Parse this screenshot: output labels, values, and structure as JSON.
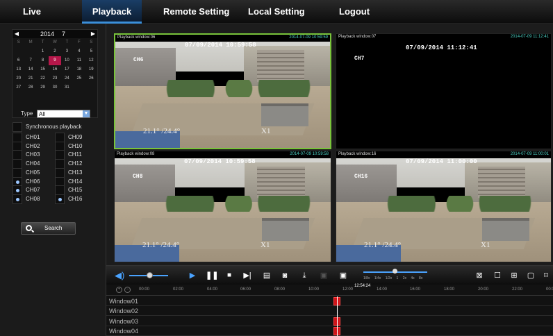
{
  "nav": {
    "tabs": [
      "Live",
      "Playback",
      "Remote Setting",
      "Local Setting",
      "Logout"
    ],
    "active": "Playback",
    "accent": "#3b8fd9"
  },
  "calendar": {
    "year": "2014",
    "month": "7",
    "prev": "◀",
    "next": "▶",
    "weekdays": [
      "S",
      "M",
      "T",
      "W",
      "T",
      "F",
      "S"
    ],
    "weeks": [
      [
        "",
        "",
        "1",
        "2",
        "3",
        "4",
        "5"
      ],
      [
        "6",
        "7",
        "8",
        "9",
        "10",
        "11",
        "12"
      ],
      [
        "13",
        "14",
        "15",
        "16",
        "17",
        "18",
        "19"
      ],
      [
        "20",
        "21",
        "22",
        "23",
        "24",
        "25",
        "26"
      ],
      [
        "27",
        "28",
        "29",
        "30",
        "31",
        "",
        ""
      ]
    ],
    "selected_day": "9",
    "selected_color": "#b5174a"
  },
  "filter": {
    "type_label": "Type",
    "type_value": "All",
    "sync_label": "Synchronous playback"
  },
  "channels": {
    "left": [
      {
        "label": "CH01",
        "checked": false
      },
      {
        "label": "CH02",
        "checked": false
      },
      {
        "label": "CH03",
        "checked": false
      },
      {
        "label": "CH04",
        "checked": false
      },
      {
        "label": "CH05",
        "checked": false
      },
      {
        "label": "CH06",
        "checked": true
      },
      {
        "label": "CH07",
        "checked": true
      },
      {
        "label": "CH08",
        "checked": true
      }
    ],
    "right": [
      {
        "label": "CH09",
        "checked": false
      },
      {
        "label": "CH10",
        "checked": false
      },
      {
        "label": "CH11",
        "checked": false
      },
      {
        "label": "CH12",
        "checked": false
      },
      {
        "label": "CH13",
        "checked": false
      },
      {
        "label": "CH14",
        "checked": false
      },
      {
        "label": "CH15",
        "checked": false
      },
      {
        "label": "CH16",
        "checked": true
      }
    ]
  },
  "search_label": "Search",
  "windows": [
    {
      "title": "Playback window:06",
      "timestamp": "2014-07-09 10:59:59",
      "osd_time": "07/09/2014 10:59:58",
      "channel": "CH6",
      "bottom_left": "21.1° /24.4°",
      "bottom_right": "X1",
      "active": true,
      "has_video": true
    },
    {
      "title": "Playback window:07",
      "timestamp": "2014-07-09 11:12:41",
      "osd_time": "07/09/2014 11:12:41",
      "channel": "CH7",
      "bottom_left": "",
      "bottom_right": "",
      "active": false,
      "has_video": false
    },
    {
      "title": "Playback window:08",
      "timestamp": "2014-07-09 10:59:58",
      "osd_time": "07/09/2014 10:59:58",
      "channel": "CH8",
      "bottom_left": "21.1° /24.4°",
      "bottom_right": "X1",
      "active": false,
      "has_video": true
    },
    {
      "title": "Playback window:16",
      "timestamp": "2014-07-09 11:00:01",
      "osd_time": "07/09/2014 11:00:00",
      "channel": "CH16",
      "bottom_left": "21.1° /24.4°",
      "bottom_right": "X1",
      "active": false,
      "has_video": true
    }
  ],
  "controls": {
    "volume_level": 0.45,
    "speed_labels": [
      "1/8x",
      "1/4x",
      "1/2x",
      "1",
      "2x",
      "4x",
      "8x"
    ],
    "speed_value": "1"
  },
  "timeline": {
    "ticks": [
      "00:00",
      "02:00",
      "04:00",
      "06:00",
      "08:00",
      "10:00",
      "12:00",
      "14:00",
      "16:00",
      "18:00",
      "20:00",
      "22:00",
      "00:00"
    ],
    "cursor_time": "12:54:24",
    "tracks": [
      "Window01",
      "Window02",
      "Window03",
      "Window04"
    ],
    "record_color": "#d0141a"
  }
}
